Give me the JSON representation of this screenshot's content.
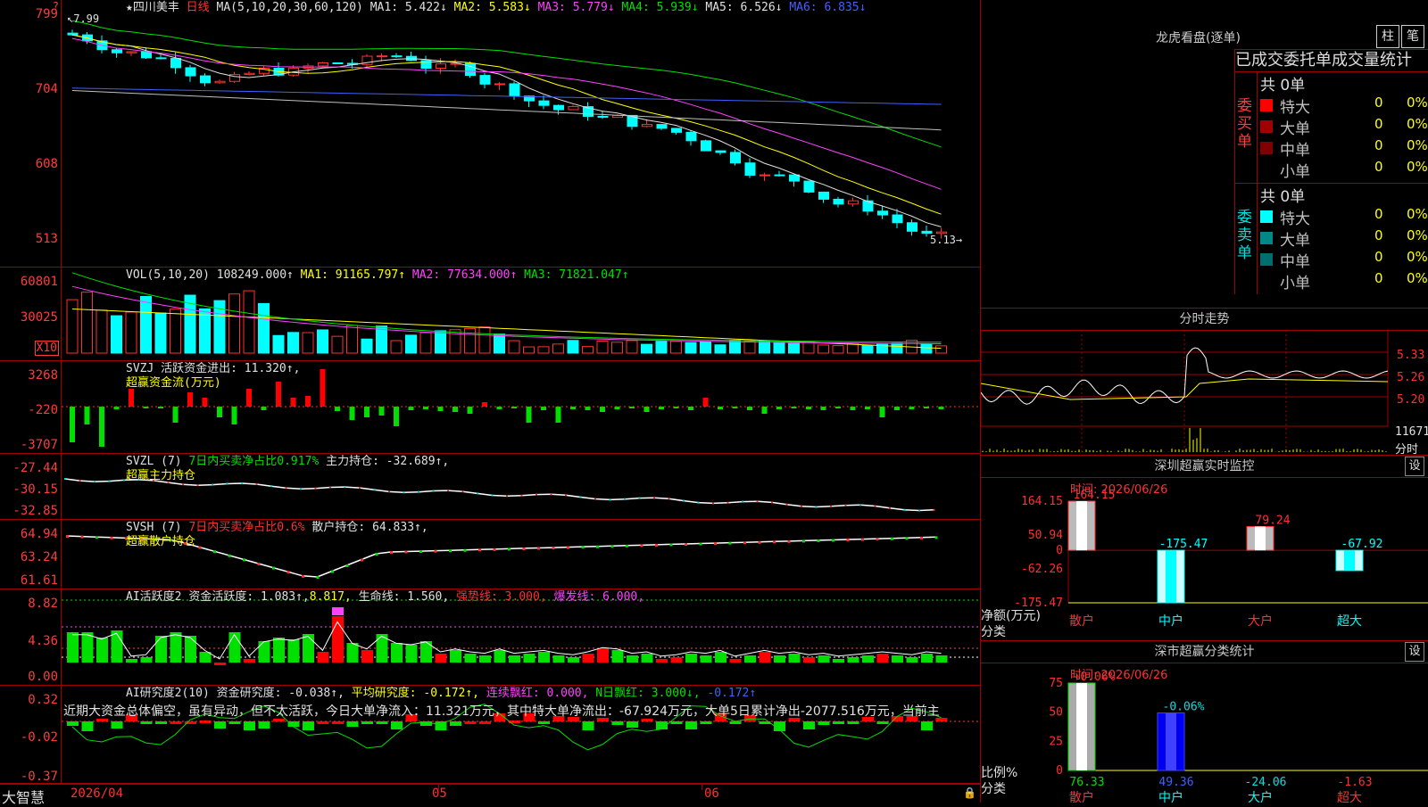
{
  "main": {
    "legend": {
      "star": "★",
      "name": "四川美丰",
      "period": "日线",
      "ma_label": "MA(5,10,20,30,60,120)",
      "ma1": "MA1: 5.422↓",
      "ma2": "MA2: 5.583↓",
      "ma3": "MA3: 5.779↓",
      "ma4": "MA4: 5.939↓",
      "ma5": "MA5: 6.526↓",
      "ma6": "MA6: 6.835↓"
    },
    "y_ticks": [
      "799",
      "704",
      "608",
      "513"
    ],
    "high_marker": "7.99",
    "low_marker": "5.13"
  },
  "volume": {
    "legend": {
      "label": "VOL(5,10,20)",
      "val": "108249.000↑",
      "ma1": "MA1: 91165.797↑",
      "ma2": "MA2: 77634.000↑",
      "ma3": "MA3: 71821.047↑"
    },
    "y_ticks": [
      "60801",
      "30025"
    ],
    "unit": "X10"
  },
  "svzj": {
    "legend": {
      "label": "SVZJ",
      "text": "活跃资金进出: 11.320↑,"
    },
    "legend2": "超赢资金流(万元)",
    "y_ticks": [
      "3268",
      "-220",
      "-3707"
    ]
  },
  "svzl": {
    "legend": {
      "label": "SVZL (7)",
      "ratio": "7日内买卖净占比0.917%",
      "text": "主力持仓: -32.689↑,"
    },
    "legend2": "超赢主力持仓",
    "y_ticks": [
      "-27.44",
      "-30.15",
      "-32.85"
    ]
  },
  "svsh": {
    "legend": {
      "label": "SVSH (7)",
      "ratio": "7日内买卖净占比0.6%",
      "text": "散户持仓: 64.833↑,"
    },
    "legend2": "超赢散户持仓",
    "y_ticks": [
      "64.94",
      "63.24",
      "61.61"
    ]
  },
  "ai1": {
    "legend": {
      "label": "AI活跃度2",
      "act": "资金活跃度: 1.083↑,",
      "v2": "8.817,",
      "life": "生命线: 1.560,",
      "strong": "强势线: 3.000,",
      "burst": "爆发线: 6.000,"
    },
    "y_ticks": [
      "8.82",
      "4.36",
      "0.00"
    ]
  },
  "ai2": {
    "legend": {
      "label": "AI研究度2(10)",
      "res": "资金研究度: -0.038↑,",
      "avg": "平均研究度: -0.172↑,",
      "lian": "连续飘红: 0.000,",
      "ndays": "N日飘红: 3.000↓,",
      "last": "-0.172↑"
    },
    "commentary": "近期大资金总体偏空，虽有异动，但不太活跃，今日大单净流入：11.321万元，其中特大单净流出：-67.924万元，大单5日累计净出-2077.516万元，当前主",
    "y_ticks": [
      "0.32",
      "-0.02",
      "-0.37"
    ]
  },
  "bottom": {
    "brand": "大智慧",
    "date": "2026/04",
    "m05": "05",
    "m06": "06"
  },
  "lhb": {
    "title": "龙虎看盘(逐单)",
    "btn1": "柱",
    "btn2": "笔",
    "header": "已成交委托单成交量统计",
    "buy": {
      "side": "委买单",
      "total": "共 0单",
      "rows": [
        {
          "name": "特大",
          "v": "0",
          "p": "0%",
          "color": "#ff0000"
        },
        {
          "name": "大单",
          "v": "0",
          "p": "0%",
          "color": "#a00000"
        },
        {
          "name": "中单",
          "v": "0",
          "p": "0%",
          "color": "#800000"
        },
        {
          "name": "小单",
          "v": "0",
          "p": "0%",
          "color": "#000000"
        }
      ]
    },
    "sell": {
      "side": "委卖单",
      "total": "共 0单",
      "rows": [
        {
          "name": "特大",
          "v": "0",
          "p": "0%",
          "color": "#00ffff"
        },
        {
          "name": "大单",
          "v": "0",
          "p": "0%",
          "color": "#008888"
        },
        {
          "name": "中单",
          "v": "0",
          "p": "0%",
          "color": "#006e6e"
        },
        {
          "name": "小单",
          "v": "0",
          "p": "0%",
          "color": "#000000"
        }
      ]
    }
  },
  "fenshi": {
    "title": "分时走势",
    "y_ticks": [
      "5.33",
      "5.26",
      "5.20"
    ],
    "vol_tick": "11671",
    "vol_unit": "分时"
  },
  "szmon": {
    "title": "深圳超赢实时监控",
    "set": "设",
    "time": "时间: 2026/06/26",
    "y_ticks": [
      "164.15",
      "50.94",
      "0",
      "-62.26",
      "-175.47"
    ],
    "ylabel": "净额(万元)",
    "xlabel": "分类",
    "chart_data": {
      "type": "bar",
      "categories": [
        "散户",
        "中户",
        "大户",
        "超大"
      ],
      "values": [
        164.15,
        -175.47,
        79.24,
        -67.92
      ],
      "labels": [
        "164.15",
        "-175.47",
        "79.24",
        "-67.92"
      ],
      "ylim": [
        -175.47,
        164.15
      ]
    }
  },
  "szcls": {
    "title": "深市超赢分类统计",
    "set": "设",
    "time": "时间: 2026/06/26",
    "y_ticks": [
      "75",
      "50",
      "25",
      "0"
    ],
    "ylabel": "比例%",
    "xlabel": "分类",
    "chart_data": {
      "type": "bar",
      "categories": [
        "散户",
        "中户",
        "大户",
        "超大"
      ],
      "values": [
        76.33,
        49.36,
        -24.06,
        -1.63
      ],
      "labels": [
        "76.33",
        "49.36",
        "-24.06",
        "-1.63"
      ],
      "top_labels": [
        "+0.06%",
        "-0.06%"
      ],
      "ylim": [
        0,
        75
      ]
    }
  }
}
